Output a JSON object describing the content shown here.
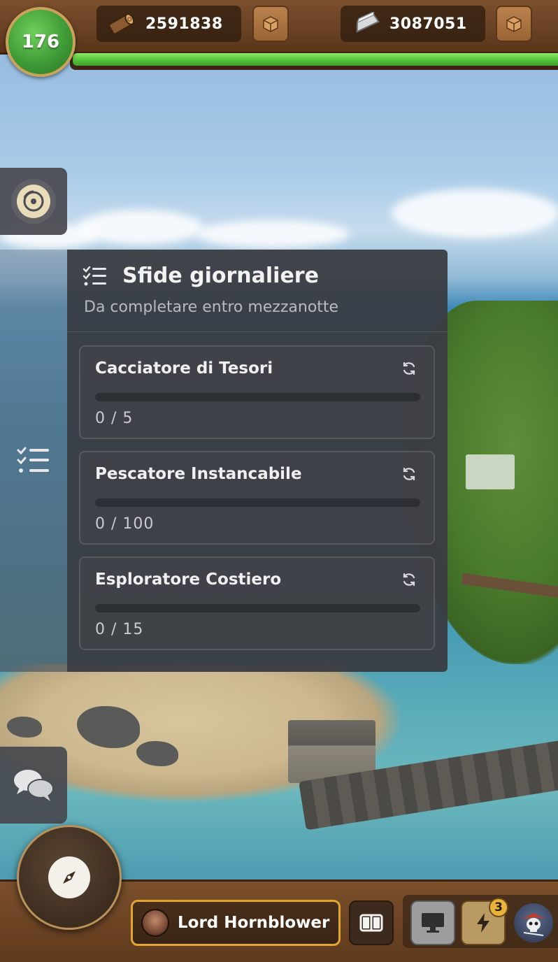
{
  "hud": {
    "level": "176",
    "xp_progress": 1.0,
    "resources": [
      {
        "name": "wood",
        "value": "2591838",
        "icon": "log-icon"
      },
      {
        "name": "metal",
        "value": "3087051",
        "icon": "ingot-icon"
      }
    ]
  },
  "panel": {
    "title": "Sfide giornaliere",
    "subtitle": "Da completare entro mezzanotte",
    "challenges": [
      {
        "title": "Cacciatore di Tesori",
        "progress": "0 / 5",
        "fraction": 0
      },
      {
        "title": "Pescatore Instancabile",
        "progress": "0 / 100",
        "fraction": 0
      },
      {
        "title": "Esploratore Costiero",
        "progress": "0 / 15",
        "fraction": 0
      }
    ]
  },
  "bottom": {
    "player_name": "Lord Hornblower",
    "notifications": "3"
  },
  "colors": {
    "accent": "#e2a52e",
    "xp_green": "#56c43b",
    "panel_bg": "#3a3c42",
    "wood_frame": "#6b4325"
  }
}
